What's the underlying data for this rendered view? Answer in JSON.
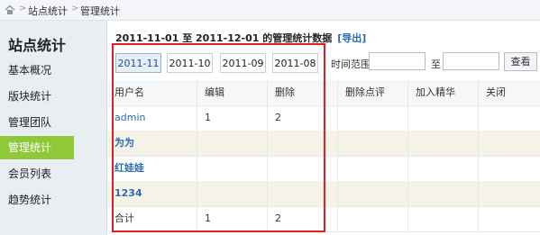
{
  "breadcrumb": {
    "items": [
      "站点统计",
      "管理统计"
    ],
    "separator": ">"
  },
  "sidebar": {
    "title": "站点统计",
    "items": [
      {
        "label": "基本概况"
      },
      {
        "label": "版块统计"
      },
      {
        "label": "管理团队"
      },
      {
        "label": "管理统计",
        "active": true
      },
      {
        "label": "会员列表"
      },
      {
        "label": "趋势统计"
      }
    ]
  },
  "main": {
    "header": "2011-11-01 至 2011-12-01 的管理统计数据",
    "export_label": "[导出]",
    "month_tabs": [
      {
        "label": "2011-11",
        "active": true
      },
      {
        "label": "2011-10"
      },
      {
        "label": "2011-09"
      },
      {
        "label": "2011-08"
      }
    ],
    "time_range_label": "时间范围:",
    "to_label": "至",
    "start_value": "",
    "end_value": "",
    "search_label": "查看",
    "columns": [
      "用户名",
      "编辑",
      "删除",
      "删除点评",
      "加入精华",
      "关闭"
    ],
    "rows": [
      {
        "user": "admin",
        "edit": "1",
        "delete": "2",
        "delete_comment": "",
        "digest": "",
        "close": "",
        "style": "link"
      },
      {
        "user": "为为",
        "edit": "",
        "delete": "",
        "delete_comment": "",
        "digest": "",
        "close": "",
        "style": "link-bold"
      },
      {
        "user": "红娃娃",
        "edit": "",
        "delete": "",
        "delete_comment": "",
        "digest": "",
        "close": "",
        "style": "link-bold"
      },
      {
        "user": "1234",
        "edit": "",
        "delete": "",
        "delete_comment": "",
        "digest": "",
        "close": "",
        "style": "link-bold"
      },
      {
        "user": "合计",
        "edit": "1",
        "delete": "2",
        "delete_comment": "",
        "digest": "",
        "close": "",
        "style": "plain"
      }
    ]
  },
  "colors": {
    "active_green": "#8fc93a",
    "link_blue": "#2b6cb0",
    "highlight_red": "#e02020"
  }
}
